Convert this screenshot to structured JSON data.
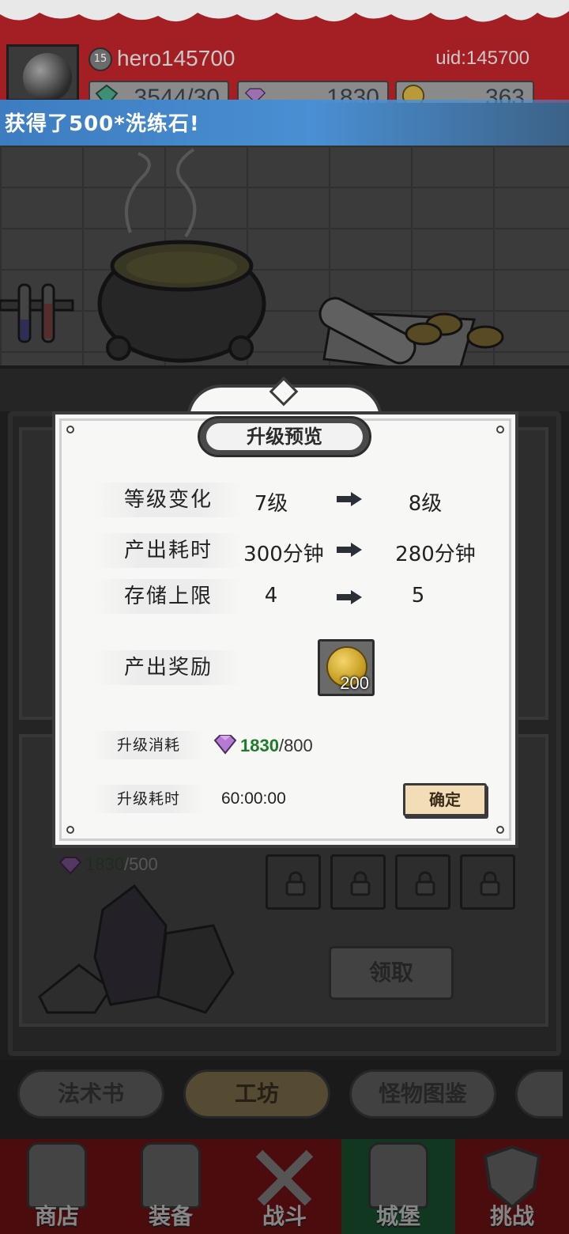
{
  "header": {
    "level": "15",
    "player_name": "hero145700",
    "uid": "uid:145700",
    "resources": [
      {
        "icon": "green-gem-icon",
        "value": "3544/30"
      },
      {
        "icon": "purple-gem-icon",
        "value": "1830"
      },
      {
        "icon": "gold-coin-icon",
        "value": "363"
      }
    ]
  },
  "toast": {
    "text": "获得了500*洗练石!"
  },
  "background": {
    "cost_have": "1830",
    "cost_need": "/500",
    "claim_label": "领取"
  },
  "tabs": [
    {
      "label": "法术书",
      "active": false
    },
    {
      "label": "工坊",
      "active": true
    },
    {
      "label": "怪物图鉴",
      "active": false
    }
  ],
  "bottom_nav": [
    {
      "label": "商店",
      "icon": "shop-icon",
      "active": false
    },
    {
      "label": "装备",
      "icon": "backpack-icon",
      "active": false
    },
    {
      "label": "战斗",
      "icon": "crossed-swords-icon",
      "active": false
    },
    {
      "label": "城堡",
      "icon": "castle-icon",
      "active": true
    },
    {
      "label": "挑战",
      "icon": "shield-icon",
      "active": false
    }
  ],
  "modal": {
    "title": "升级预览",
    "rows": [
      {
        "label": "等级变化",
        "from": "7级",
        "to": "8级"
      },
      {
        "label": "产出耗时",
        "from": "300分钟",
        "to": "280分钟"
      },
      {
        "label": "存储上限",
        "from": "4",
        "to": "5"
      }
    ],
    "reward_label": "产出奖励",
    "reward_count": "200",
    "cost_label": "升级消耗",
    "cost_have": "1830",
    "cost_need": "/800",
    "time_label": "升级耗时",
    "time_value": "60:00:00",
    "confirm_label": "确定"
  },
  "colors": {
    "header_red": "#a31f24",
    "toast_blue": "#4a8fd3",
    "cost_green": "#1f7a2a",
    "confirm_bg": "#f3ddb6",
    "nav_active": "#1e5a36"
  }
}
